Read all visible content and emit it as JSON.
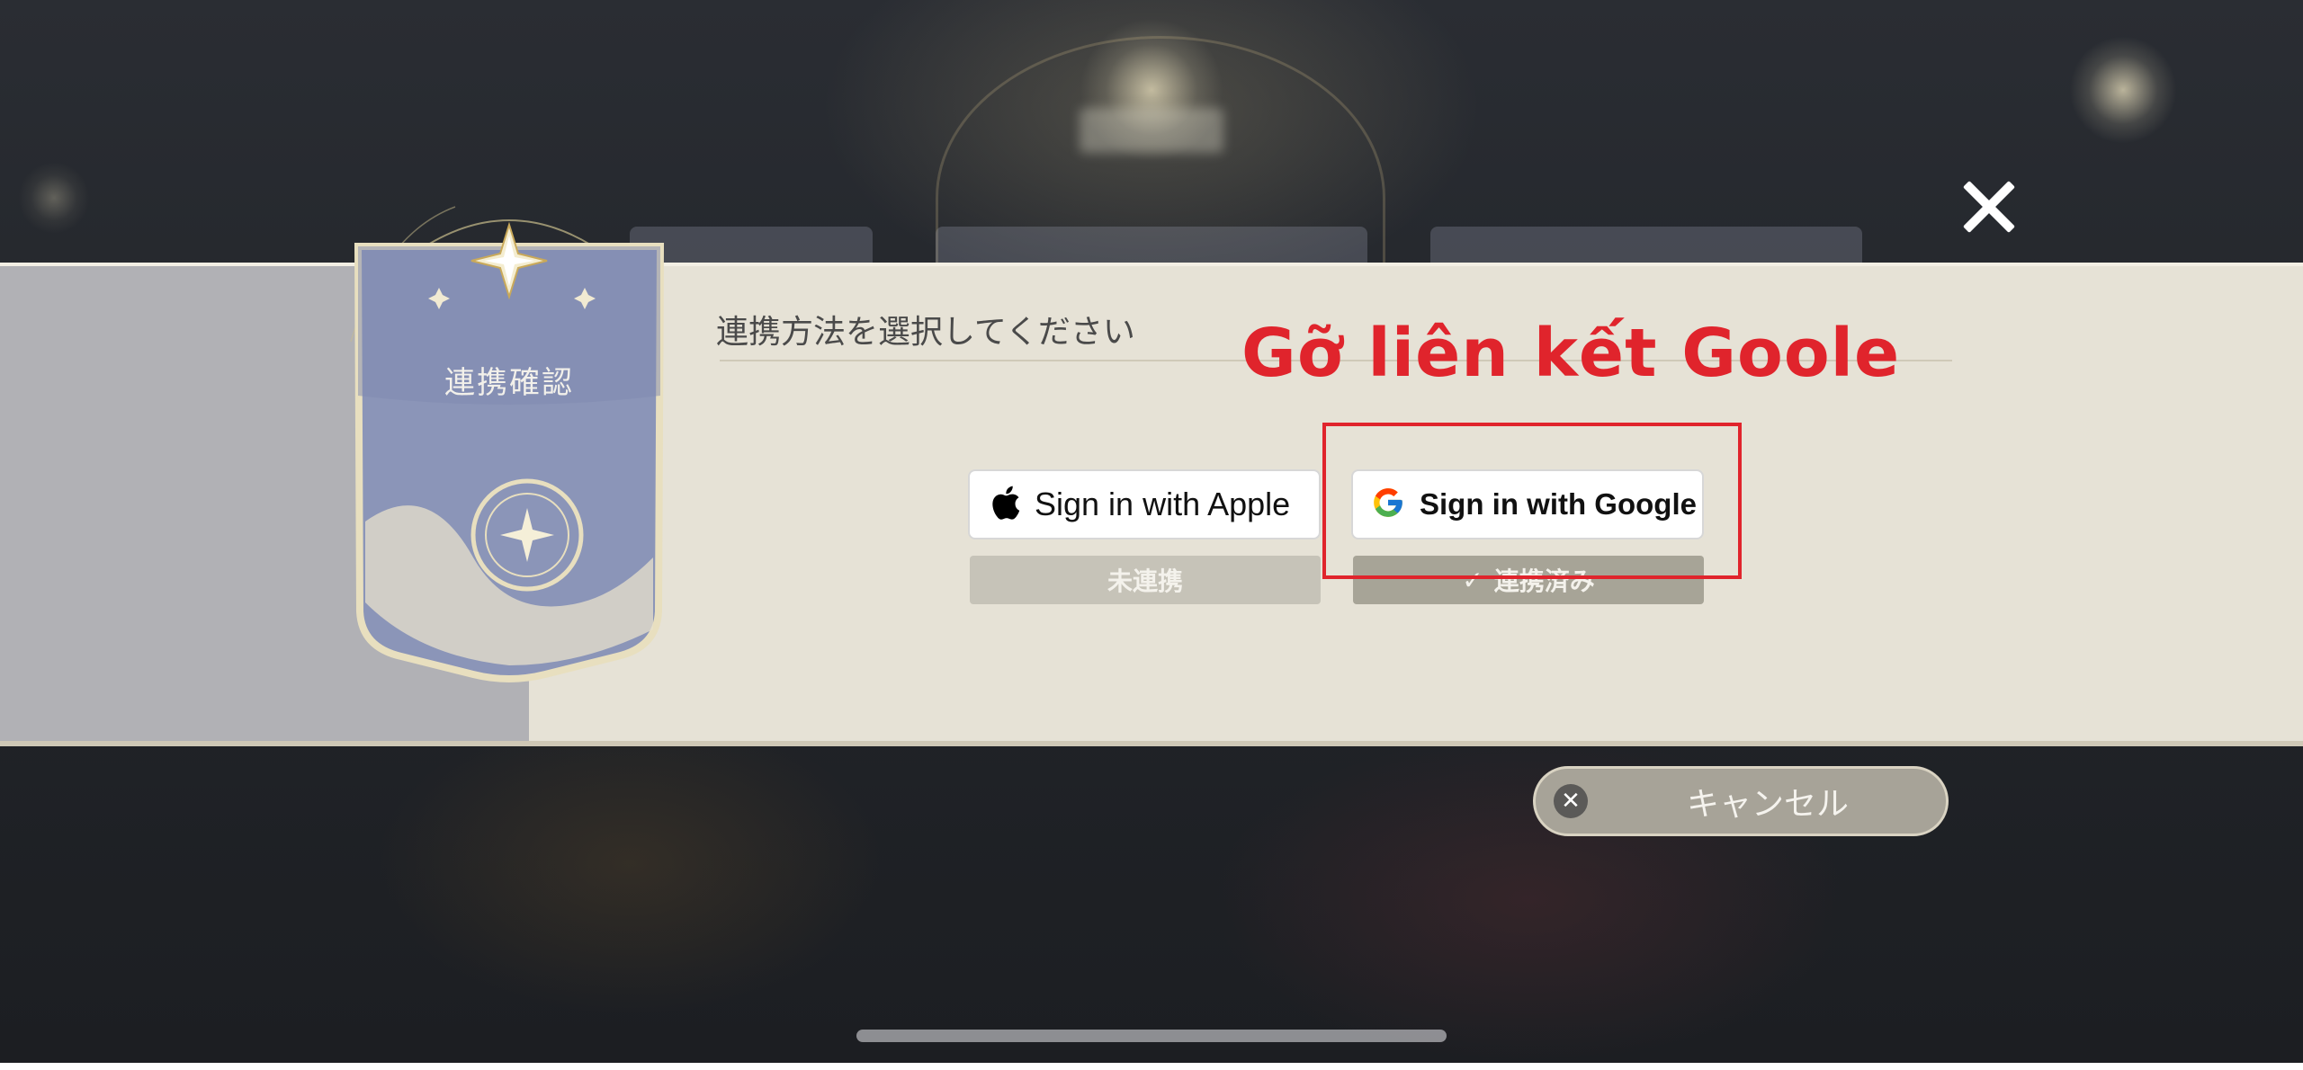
{
  "background": {
    "description_tag": "blurred game menu",
    "glow_color": "#ebe1be"
  },
  "close_icon": "close-icon",
  "emblem": {
    "title": "連携確認",
    "colors": {
      "panel": "#8b95b8",
      "gold": "#e8dfbf"
    }
  },
  "dialog": {
    "heading": "連携方法を選択してください",
    "background": "#e6e2d6",
    "left_strip": "#b1b1b5"
  },
  "annotation": {
    "text": "Gỡ liên kết Goole",
    "color": "#e0242c"
  },
  "providers": [
    {
      "label": "Sign in with Apple",
      "icon": "apple-icon",
      "status": "未連携"
    },
    {
      "label": "Sign in with Google",
      "icon": "google-icon",
      "status": "連携済み",
      "status_icon": "check-icon"
    }
  ],
  "cancel": {
    "label": "キャンセル",
    "icon": "close-circle-icon"
  }
}
